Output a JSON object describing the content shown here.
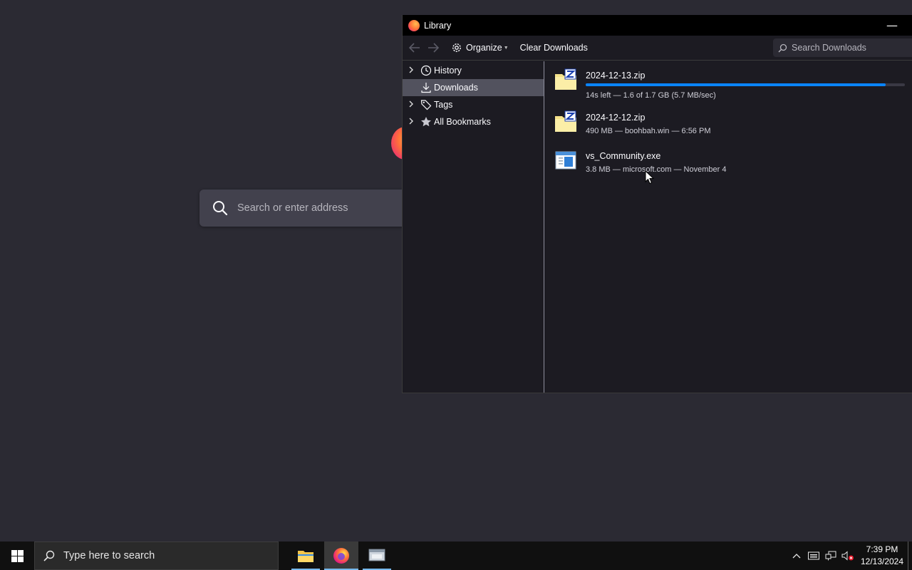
{
  "browser": {
    "address_placeholder": "Search or enter address"
  },
  "library": {
    "window_title": "Library",
    "minimize_glyph": "—",
    "toolbar": {
      "organize_label": "Organize",
      "clear_label": "Clear Downloads",
      "search_placeholder": "Search Downloads"
    },
    "sidebar": {
      "items": [
        {
          "label": "History",
          "icon": "clock-icon",
          "expandable": true
        },
        {
          "label": "Downloads",
          "icon": "download-icon",
          "expandable": false,
          "selected": true
        },
        {
          "label": "Tags",
          "icon": "tag-icon",
          "expandable": true
        },
        {
          "label": "All Bookmarks",
          "icon": "star-icon",
          "expandable": true
        }
      ]
    },
    "downloads": [
      {
        "name": "2024-12-13.zip",
        "status": "14s left — 1.6 of 1.7 GB (5.7 MB/sec)",
        "icon": "zip-folder-icon",
        "progress": 0.94
      },
      {
        "name": "2024-12-12.zip",
        "status": "490 MB — boohbah.win — 6:56 PM",
        "icon": "zip-folder-icon"
      },
      {
        "name": "vs_Community.exe",
        "status": "3.8 MB — microsoft.com — November 4",
        "icon": "exe-file-icon"
      }
    ]
  },
  "taskbar": {
    "search_placeholder": "Type here to search",
    "apps": [
      {
        "name": "file-explorer",
        "active": false
      },
      {
        "name": "firefox",
        "active": true
      },
      {
        "name": "library-window",
        "active": false
      }
    ],
    "clock": {
      "time": "7:39 PM",
      "date": "12/13/2024"
    }
  },
  "colors": {
    "accent": "#0a84ff",
    "background": "#2b2a33",
    "sidebar_selected": "#52525e"
  }
}
